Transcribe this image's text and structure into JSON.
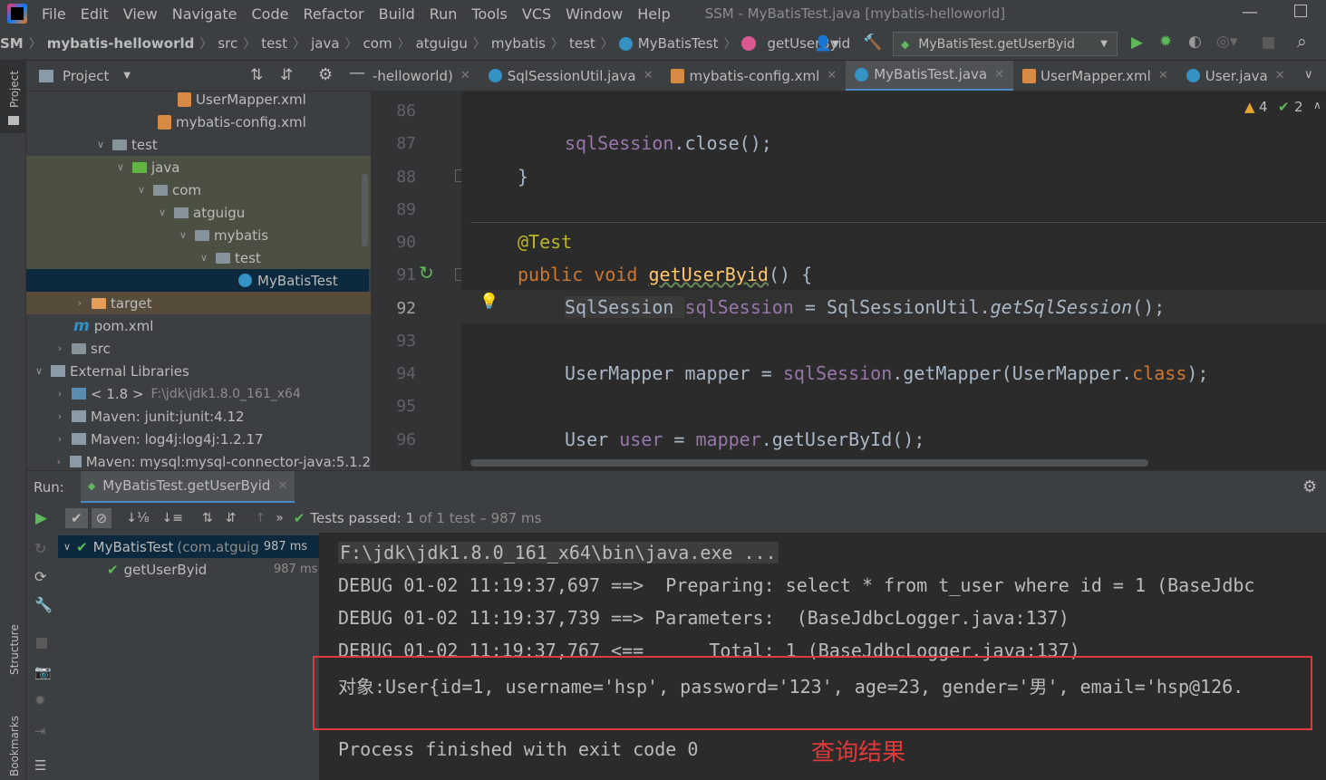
{
  "menu": {
    "items": [
      "File",
      "Edit",
      "View",
      "Navigate",
      "Code",
      "Refactor",
      "Build",
      "Run",
      "Tools",
      "VCS",
      "Window",
      "Help"
    ],
    "window_title": "SSM - MyBatisTest.java [mybatis-helloworld]"
  },
  "breadcrumbs": [
    "SM",
    "mybatis-helloworld",
    "src",
    "test",
    "java",
    "com",
    "atguigu",
    "mybatis",
    "test",
    "MyBatisTest",
    "getUserByid"
  ],
  "run_config": "MyBatisTest.getUserByid",
  "project_panel": {
    "title": "Project",
    "tree": [
      {
        "label": "UserMapper.xml",
        "icon": "xml-file-icon"
      },
      {
        "label": "mybatis-config.xml",
        "icon": "xml-file-icon"
      },
      {
        "label": "test",
        "icon": "folder-icon"
      },
      {
        "label": "java",
        "icon": "test-source-folder-icon"
      },
      {
        "label": "com",
        "icon": "package-icon"
      },
      {
        "label": "atguigu",
        "icon": "package-icon"
      },
      {
        "label": "mybatis",
        "icon": "package-icon"
      },
      {
        "label": "test",
        "icon": "package-icon"
      },
      {
        "label": "MyBatisTest",
        "icon": "class-icon"
      },
      {
        "label": "target",
        "icon": "excluded-folder-icon"
      },
      {
        "label": "pom.xml",
        "icon": "maven-icon"
      },
      {
        "label": "src",
        "icon": "folder-icon"
      },
      {
        "label": "External Libraries",
        "icon": "library-icon"
      },
      {
        "label": "< 1.8 >",
        "extra": "F:\\jdk\\jdk1.8.0_161_x64",
        "icon": "jdk-icon"
      },
      {
        "label": "Maven: junit:junit:4.12",
        "icon": "library-icon"
      },
      {
        "label": "Maven: log4j:log4j:1.2.17",
        "icon": "library-icon"
      },
      {
        "label": "Maven: mysql:mysql-connector-java:5.1.2",
        "icon": "library-icon"
      }
    ]
  },
  "editor_tabs": [
    {
      "label": "-helloworld)",
      "icon": "none"
    },
    {
      "label": "SqlSessionUtil.java",
      "icon": "class-icon"
    },
    {
      "label": "mybatis-config.xml",
      "icon": "xml-file-icon"
    },
    {
      "label": "MyBatisTest.java",
      "icon": "class-icon",
      "active": true
    },
    {
      "label": "UserMapper.xml",
      "icon": "xml-file-icon"
    },
    {
      "label": "User.java",
      "icon": "class-icon"
    }
  ],
  "inspections": {
    "warnings": "4",
    "ok": "2"
  },
  "line_numbers": [
    "86",
    "87",
    "88",
    "89",
    "90",
    "91",
    "92",
    "93",
    "94",
    "95",
    "96"
  ],
  "code": {
    "l87": [
      "sqlSession",
      ".close();"
    ],
    "l88": "}",
    "l90": "@Test",
    "l91": [
      "public void ",
      "getUserByid",
      "() {"
    ],
    "l92": [
      "SqlSession ",
      "sqlSession",
      " = SqlSessionUtil.",
      "getSqlSession",
      "();"
    ],
    "l94": [
      "UserMapper ",
      "mapper",
      " = ",
      "sqlSession",
      ".getMapper(UserMapper.",
      "class",
      ");"
    ],
    "l96": [
      "User ",
      "user",
      " = ",
      "mapper",
      ".getUserById();"
    ]
  },
  "run_panel": {
    "label": "Run:",
    "tab": "MyBatisTest.getUserByid",
    "status": "Tests passed:",
    "status_count": "1",
    "status_rest": "of 1 test – 987 ms"
  },
  "test_tree": [
    {
      "label": "MyBatisTest",
      "sub": "(com.atguig",
      "time": "987 ms"
    },
    {
      "label": "getUserByid",
      "time": "987 ms"
    }
  ],
  "console_lines": [
    "F:\\jdk\\jdk1.8.0_161_x64\\bin\\java.exe ...",
    "DEBUG 01-02 11:19:37,697 ==>  Preparing: select * from t_user where id = 1 (BaseJdbc",
    "DEBUG 01-02 11:19:37,739 ==> Parameters:  (BaseJdbcLogger.java:137)",
    "DEBUG 01-02 11:19:37,767 <==      Total: 1 (BaseJdbcLogger.java:137)",
    "对象:User{id=1, username='hsp', password='123', age=23, gender='男', email='hsp@126.",
    "Process finished with exit code 0"
  ],
  "annotation_text": "查询结果",
  "colors": {
    "annotation": "#e0393a",
    "accent": "#4a88c7",
    "pass_green": "#5fb85c"
  }
}
